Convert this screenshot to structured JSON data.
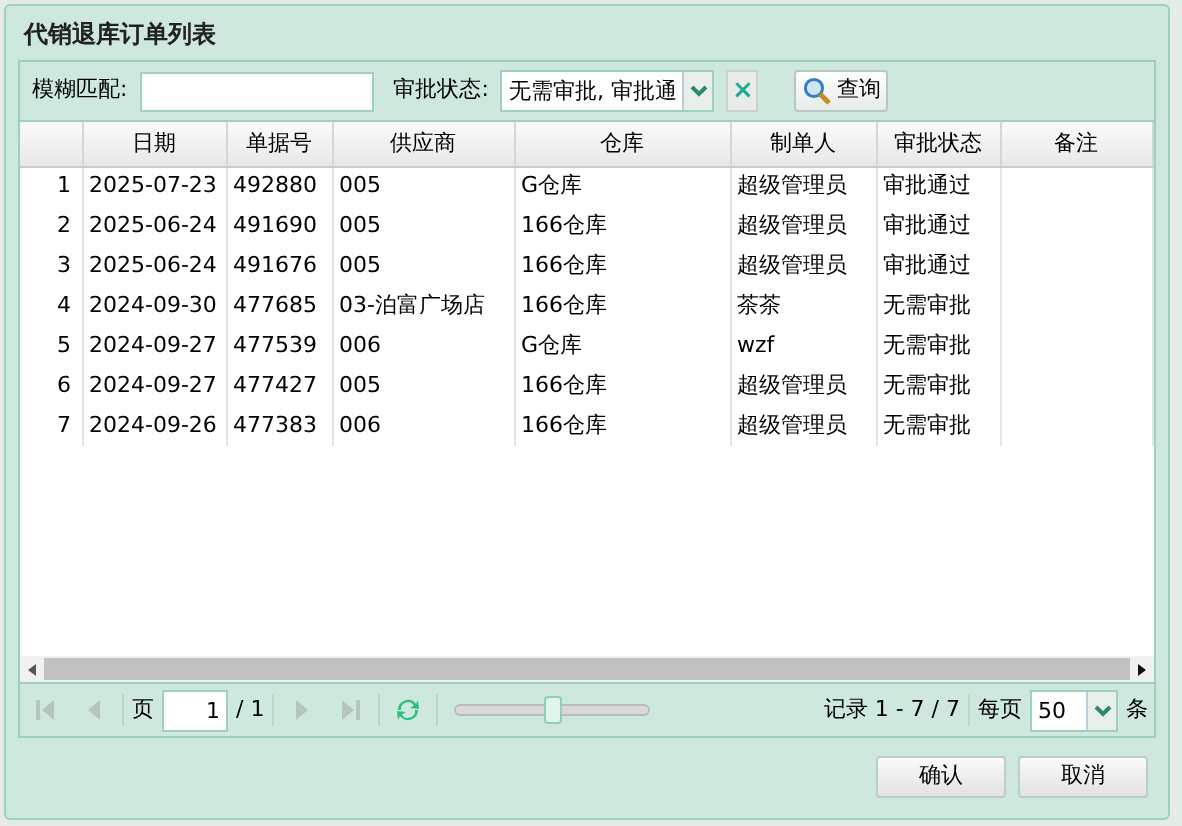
{
  "window": {
    "title": "代销退库订单列表"
  },
  "filter": {
    "keyword_label": "模糊匹配:",
    "status_label": "审批状态:",
    "status_value": "无需审批, 审批通",
    "clear_symbol": "×",
    "query_button": "查询"
  },
  "table": {
    "columns": [
      "日期",
      "单据号",
      "供应商",
      "仓库",
      "制单人",
      "审批状态",
      "备注"
    ],
    "rows": [
      {
        "index": "1",
        "cells": [
          "2025-07-23",
          "492880",
          "005",
          "G仓库",
          "超级管理员",
          "审批通过"
        ]
      },
      {
        "index": "2",
        "cells": [
          "2025-06-24",
          "491690",
          "005",
          "166仓库",
          "超级管理员",
          "审批通过"
        ]
      },
      {
        "index": "3",
        "cells": [
          "2025-06-24",
          "491676",
          "005",
          "166仓库",
          "超级管理员",
          "审批通过"
        ]
      },
      {
        "index": "4",
        "cells": [
          "2024-09-30",
          "477685",
          "03-泊富广场店",
          "166仓库",
          "茶茶",
          "无需审批"
        ]
      },
      {
        "index": "5",
        "cells": [
          "2024-09-27",
          "477539",
          "006",
          "G仓库",
          "wzf",
          "无需审批"
        ]
      },
      {
        "index": "6",
        "cells": [
          "2024-09-27",
          "477427",
          "005",
          "166仓库",
          "超级管理员",
          "无需审批"
        ]
      },
      {
        "index": "7",
        "cells": [
          "2024-09-26",
          "477383",
          "006",
          "166仓库",
          "超级管理员",
          "无需审批"
        ]
      }
    ]
  },
  "pager": {
    "page_label": "页",
    "page_value": "1",
    "page_total": "/ 1",
    "zoom": {
      "level": 0.5
    },
    "records": "记录 1 - 7 / 7",
    "per_page_label": "每页",
    "per_page_value": "50",
    "per_page_unit": "条"
  },
  "buttons": [
    "确认",
    "取消"
  ]
}
